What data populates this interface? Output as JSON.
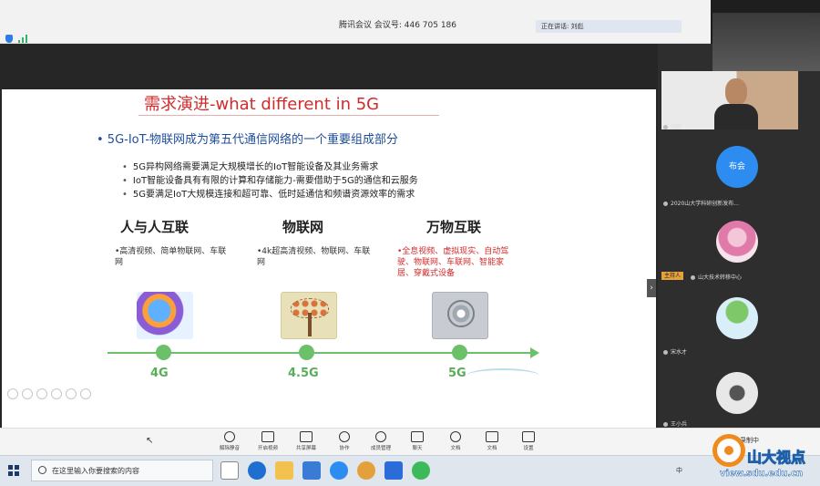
{
  "window": {
    "meeting_title": "腾讯会议 会议号: 446 705 186",
    "speaking_text": "正在讲话: 刘彪"
  },
  "slide": {
    "title": "需求演进-what different in 5G",
    "main_bullet": "• 5G-IoT-物联网成为第五代通信网络的一个重要组成部分",
    "sub_bullets": [
      "5G异构网络需要满足大规模增长的IoT智能设备及其业务需求",
      "IoT智能设备具有有限的计算和存储能力-需要借助于5G的通信和云服务",
      "5G要满足IoT大规模连接和超可靠、低时延通信和频谱资源效率的需求"
    ],
    "columns": [
      {
        "heading": "人与人互联",
        "desc": "•高清视频、简单物联网、车联网"
      },
      {
        "heading": "物联网",
        "desc": "•4k超高清视频、物联网、车联网"
      },
      {
        "heading": "万物互联",
        "desc": "•全息视频、虚拟现实、自动驾驶、物联网、车联网、智能家居、穿戴式设备"
      }
    ],
    "timeline": [
      "4G",
      "4.5G",
      "5G"
    ],
    "accent_red": "#d12b2b",
    "accent_green": "#6cc06a"
  },
  "participants": {
    "main_name": "刘彪",
    "tile_2_label": "布会",
    "tile_2_caption": "2020山大学科研创新发布...",
    "host_tag": "主持人",
    "tile_3_caption": "山大技术转移中心",
    "tile_4_caption": "宋水才",
    "tile_5_caption": "王小兵",
    "status_text": "录制中"
  },
  "toolbar": {
    "buttons": [
      "解除静音",
      "开启视频",
      "共享屏幕",
      "协作",
      "成员管理",
      "聊天",
      "文档",
      "文档",
      "设置"
    ]
  },
  "taskbar": {
    "search_placeholder": "在这里输入你要搜索的内容",
    "tray_lang": "中"
  },
  "watermark": {
    "name": "山大视点",
    "url": "view.sdu.edu.cn"
  }
}
